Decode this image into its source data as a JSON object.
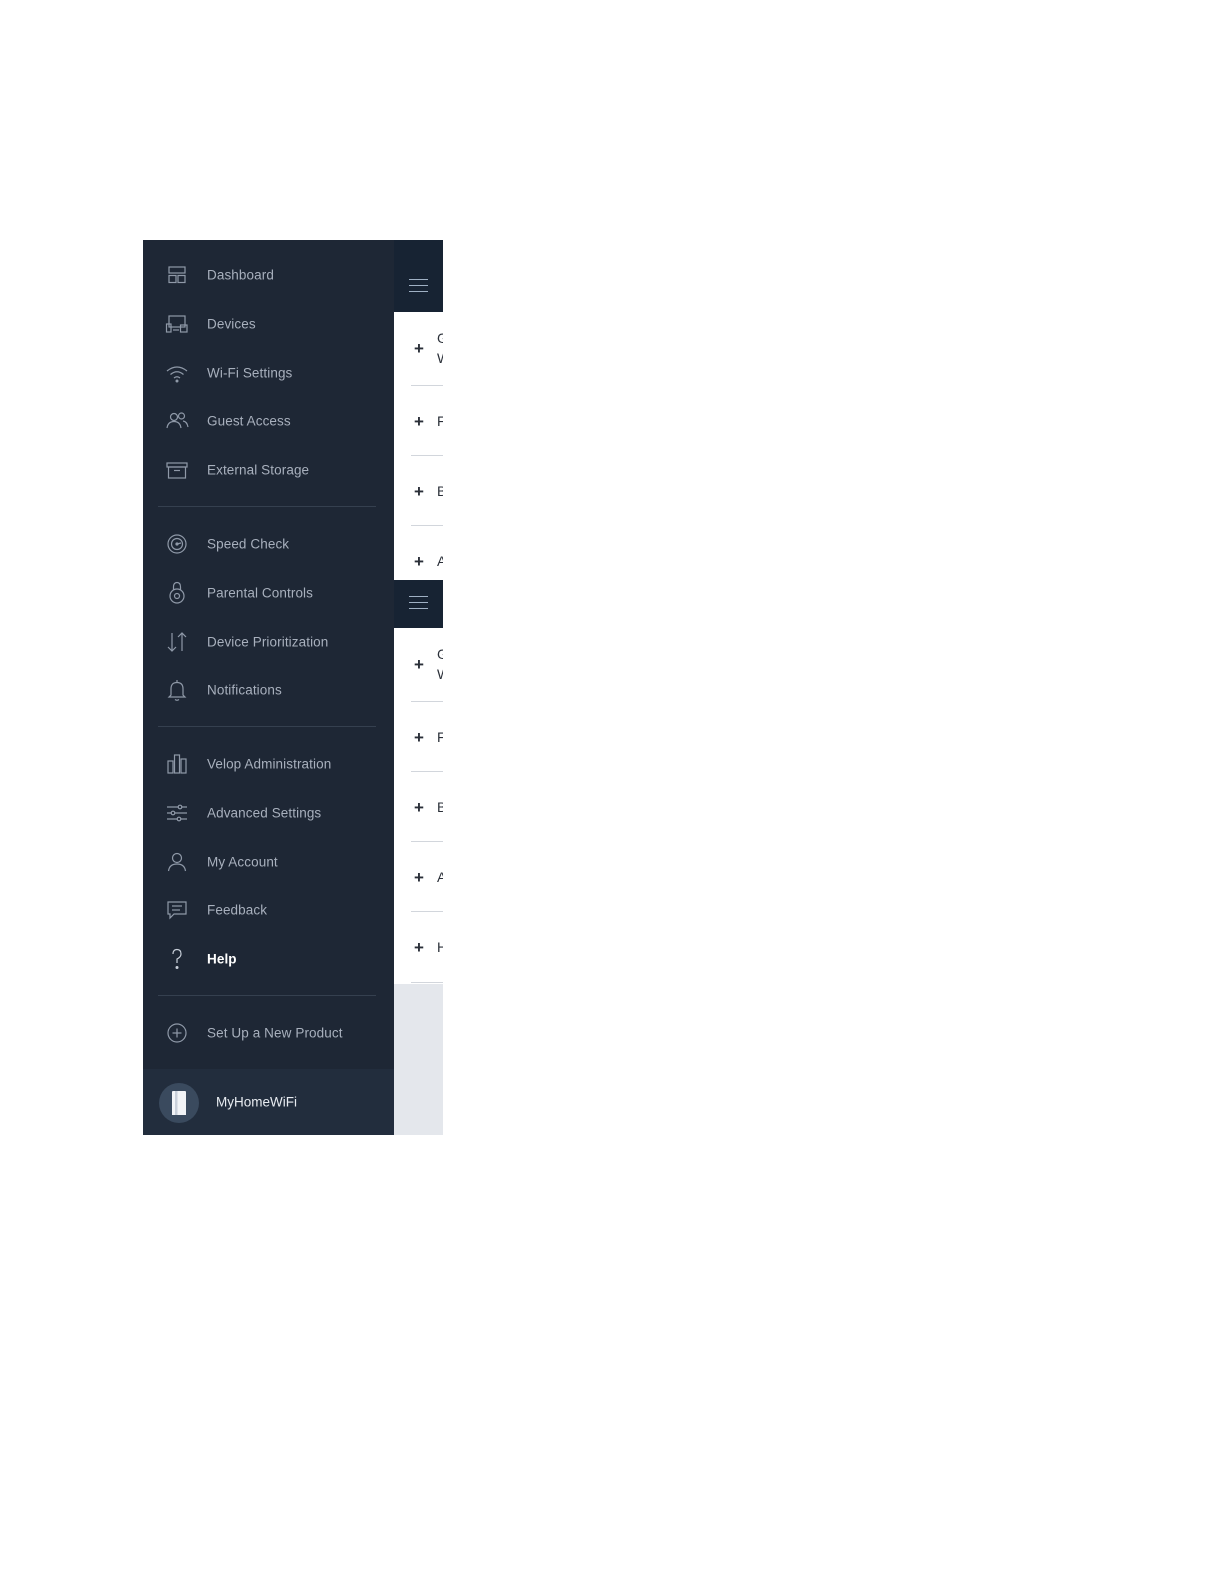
{
  "sidebar": {
    "items": [
      {
        "label": "Dashboard",
        "icon": "dashboard-icon"
      },
      {
        "label": "Devices",
        "icon": "devices-icon"
      },
      {
        "label": "Wi-Fi Settings",
        "icon": "wifi-icon"
      },
      {
        "label": "Guest Access",
        "icon": "guest-access-icon"
      },
      {
        "label": "External Storage",
        "icon": "external-storage-icon"
      },
      {
        "label": "Speed Check",
        "icon": "speed-check-icon"
      },
      {
        "label": "Parental Controls",
        "icon": "parental-controls-icon"
      },
      {
        "label": "Device Prioritization",
        "icon": "device-prioritization-icon"
      },
      {
        "label": "Notifications",
        "icon": "notifications-icon"
      },
      {
        "label": "Velop Administration",
        "icon": "velop-administration-icon"
      },
      {
        "label": "Advanced Settings",
        "icon": "advanced-settings-icon"
      },
      {
        "label": "My Account",
        "icon": "my-account-icon"
      },
      {
        "label": "Feedback",
        "icon": "feedback-icon"
      },
      {
        "label": "Help",
        "icon": "help-icon",
        "active": true
      },
      {
        "label": "Set Up a New Product",
        "icon": "add-product-icon"
      }
    ],
    "network_name": "MyHomeWiFi"
  },
  "peek_panel": {
    "panel1": {
      "rows": [
        {
          "plus": "+",
          "lines": [
            "G",
            "W"
          ]
        },
        {
          "plus": "+",
          "lines": [
            "F"
          ]
        },
        {
          "plus": "+",
          "lines": [
            "B"
          ]
        },
        {
          "plus": "+",
          "lines": [
            "A"
          ]
        }
      ]
    },
    "panel2": {
      "rows": [
        {
          "plus": "+",
          "lines": [
            "G",
            "W"
          ]
        },
        {
          "plus": "+",
          "lines": [
            "F"
          ]
        },
        {
          "plus": "+",
          "lines": [
            "B"
          ]
        },
        {
          "plus": "+",
          "lines": [
            "A"
          ]
        },
        {
          "plus": "+",
          "lines": [
            "H"
          ]
        }
      ]
    }
  },
  "colors": {
    "sidebar_bg": "#1e2735",
    "topbar_bg": "#172333",
    "panel_bg": "#e4e7ec",
    "label": "#a8b0bd",
    "active_label": "#ffffff"
  }
}
